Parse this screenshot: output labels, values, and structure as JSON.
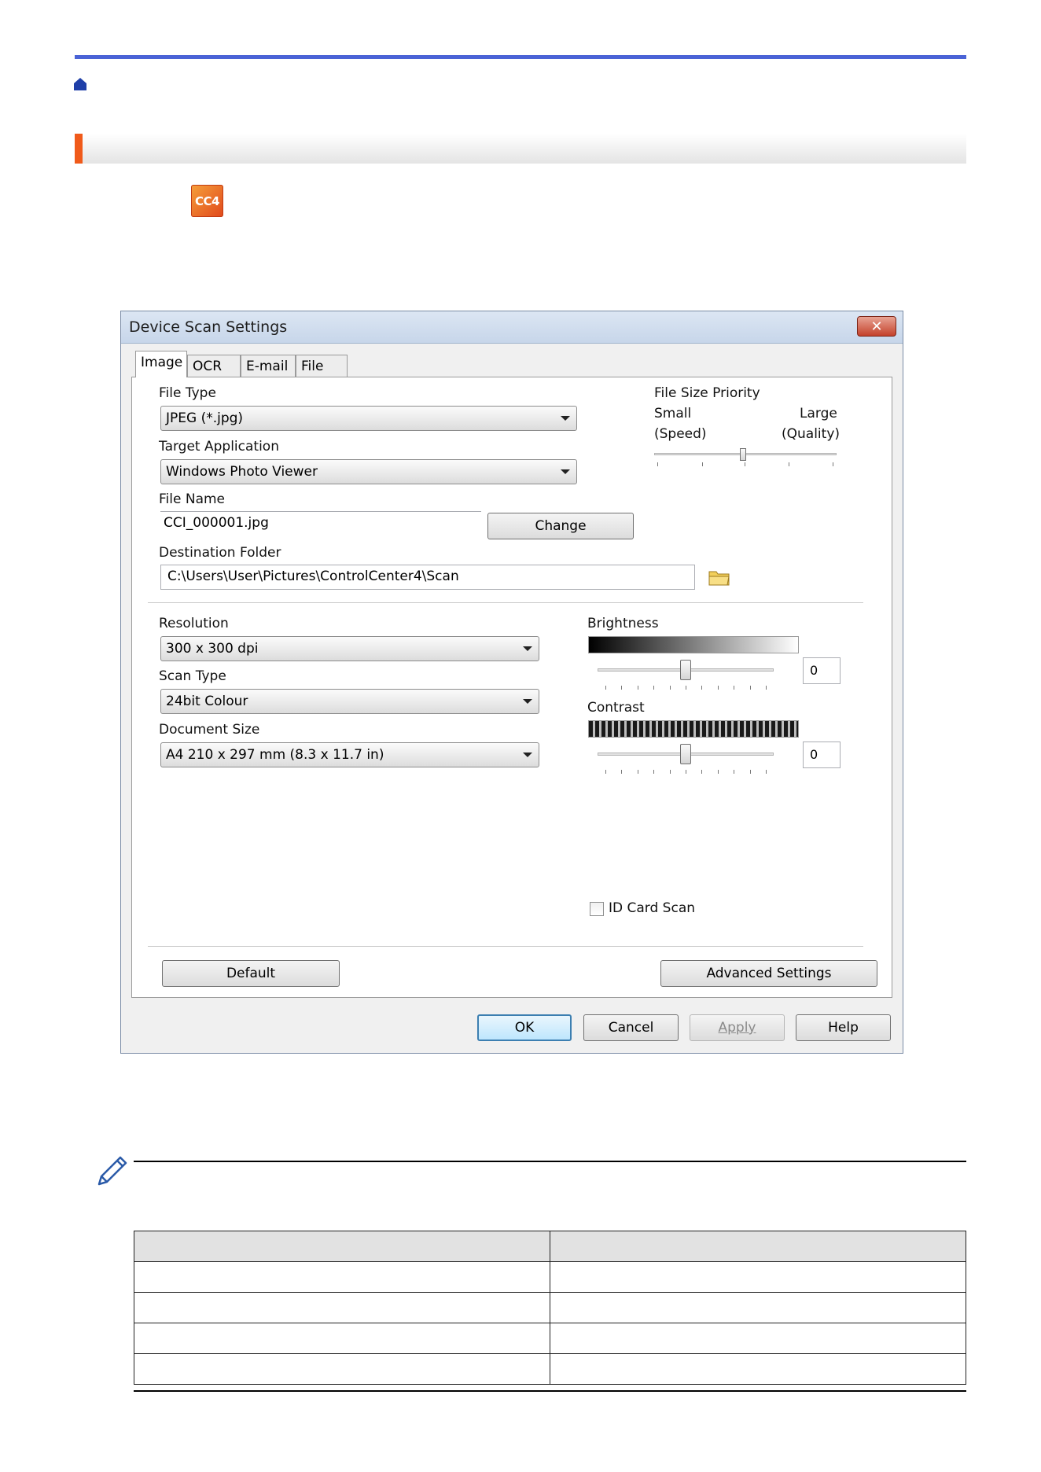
{
  "dialog": {
    "title": "Device Scan Settings",
    "close_glyph": "✕",
    "tabs": [
      "Image",
      "OCR",
      "E-mail",
      "File"
    ],
    "file_type": {
      "label": "File Type",
      "value": "JPEG (*.jpg)"
    },
    "target_application": {
      "label": "Target Application",
      "value": "Windows Photo Viewer"
    },
    "file_name": {
      "label": "File Name",
      "value": "CCI_000001.jpg",
      "change_button": "Change"
    },
    "destination_folder": {
      "label": "Destination Folder",
      "value": "C:\\Users\\User\\Pictures\\ControlCenter4\\Scan"
    },
    "file_size_priority": {
      "label": "File Size Priority",
      "small": "Small",
      "speed": "(Speed)",
      "large": "Large",
      "quality": "(Quality)",
      "level": 0.5
    },
    "resolution": {
      "label": "Resolution",
      "value": "300 x 300 dpi"
    },
    "scan_type": {
      "label": "Scan Type",
      "value": "24bit Colour"
    },
    "document_size": {
      "label": "Document Size",
      "value": "A4 210 x 297 mm (8.3 x 11.7 in)"
    },
    "brightness": {
      "label": "Brightness",
      "value": "0",
      "level": 0.5
    },
    "contrast": {
      "label": "Contrast",
      "value": "0",
      "level": 0.5
    },
    "id_card_scan": {
      "label": "ID Card Scan",
      "checked": false
    },
    "buttons": {
      "default": "Default",
      "advanced": "Advanced Settings",
      "ok": "OK",
      "cancel": "Cancel",
      "apply": "Apply",
      "help": "Help"
    }
  },
  "page": {
    "app_icon_text": "CC4"
  },
  "colors": {
    "accent_rule": "#4a63d6",
    "section_marker": "#f05a1a"
  }
}
